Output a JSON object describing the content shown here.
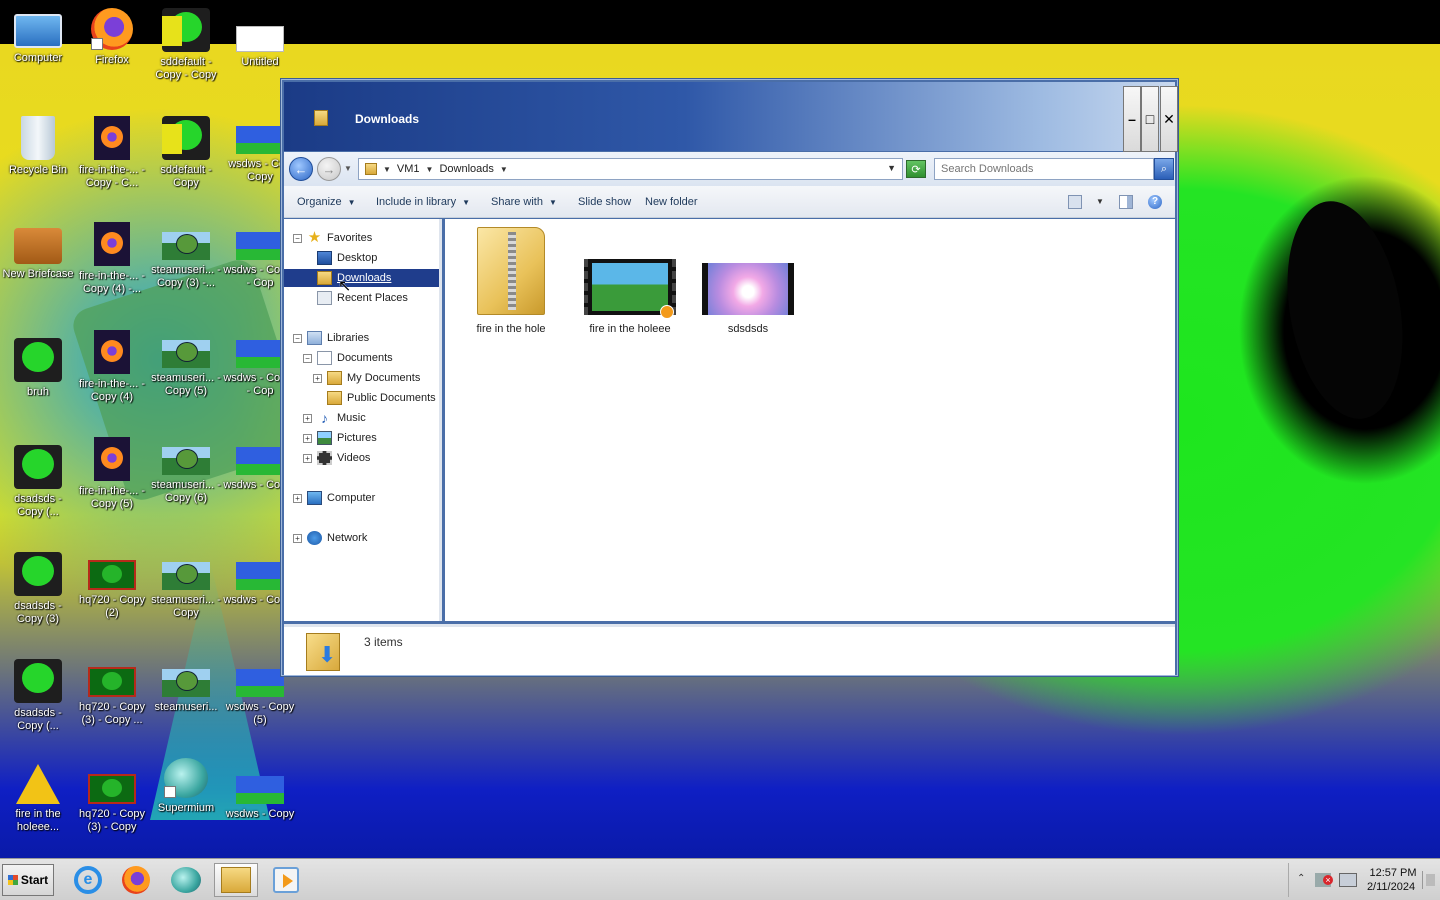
{
  "desktop": {
    "icons": [
      {
        "label": "Computer"
      },
      {
        "label": "Firefox"
      },
      {
        "label": "sddefault - Copy - Copy"
      },
      {
        "label": "Untitled"
      },
      {
        "label": "Recycle Bin"
      },
      {
        "label": "fire-in-the-... - Copy - C..."
      },
      {
        "label": "sddefault - Copy"
      },
      {
        "label": "wsdws - Co - Copy"
      },
      {
        "label": "New Briefcase"
      },
      {
        "label": "fire-in-the-... - Copy (4) -..."
      },
      {
        "label": "steamuseri... - Copy (3) -..."
      },
      {
        "label": "wsdws - Co (2) - Cop"
      },
      {
        "label": "bruh"
      },
      {
        "label": "fire-in-the-... - Copy (4)"
      },
      {
        "label": "steamuseri... - Copy (5)"
      },
      {
        "label": "wsdws - Co (3) - Cop"
      },
      {
        "label": "dsadsds - Copy (..."
      },
      {
        "label": "fire-in-the-... - Copy (5)"
      },
      {
        "label": "steamuseri... - Copy (6)"
      },
      {
        "label": "wsdws - Co (3)"
      },
      {
        "label": "dsadsds - Copy (3)"
      },
      {
        "label": "hq720 - Copy (2)"
      },
      {
        "label": "steamuseri... - Copy"
      },
      {
        "label": "wsdws - Co (4)"
      },
      {
        "label": "dsadsds - Copy (..."
      },
      {
        "label": "hq720 - Copy (3) - Copy ..."
      },
      {
        "label": "steamuseri..."
      },
      {
        "label": "wsdws - Copy (5)"
      },
      {
        "label": "fire in the holeee..."
      },
      {
        "label": "hq720 - Copy (3) - Copy"
      },
      {
        "label": "Supermium"
      },
      {
        "label": "wsdws - Copy"
      }
    ]
  },
  "window": {
    "title": "Downloads",
    "address": {
      "segments": [
        "VM1",
        "Downloads"
      ]
    },
    "search": {
      "placeholder": "Search Downloads"
    },
    "toolbar": {
      "organize": "Organize",
      "include_in_library": "Include in library",
      "share_with": "Share with",
      "slide_show": "Slide show",
      "new_folder": "New folder"
    },
    "nav": {
      "favorites": "Favorites",
      "desktop": "Desktop",
      "downloads": "Downloads",
      "recent_places": "Recent Places",
      "libraries": "Libraries",
      "documents": "Documents",
      "my_documents": "My Documents",
      "public_documents": "Public Documents",
      "music": "Music",
      "pictures": "Pictures",
      "videos": "Videos",
      "computer": "Computer",
      "network": "Network"
    },
    "files": [
      {
        "name": "fire in the hole",
        "icon": "zip-folder-icon"
      },
      {
        "name": "fire in the holeee",
        "icon": "video-thumbnail"
      },
      {
        "name": "sdsdsds",
        "icon": "image-thumbnail"
      }
    ],
    "status": {
      "count": "3 items"
    }
  },
  "taskbar": {
    "start_label": "Start",
    "clock": {
      "time": "12:57 PM",
      "date": "2/11/2024"
    }
  },
  "colors": {
    "title_gradient_start": "#1b3b86",
    "selection": "#1f3d8c",
    "taskbar": "#d6d6d6"
  }
}
